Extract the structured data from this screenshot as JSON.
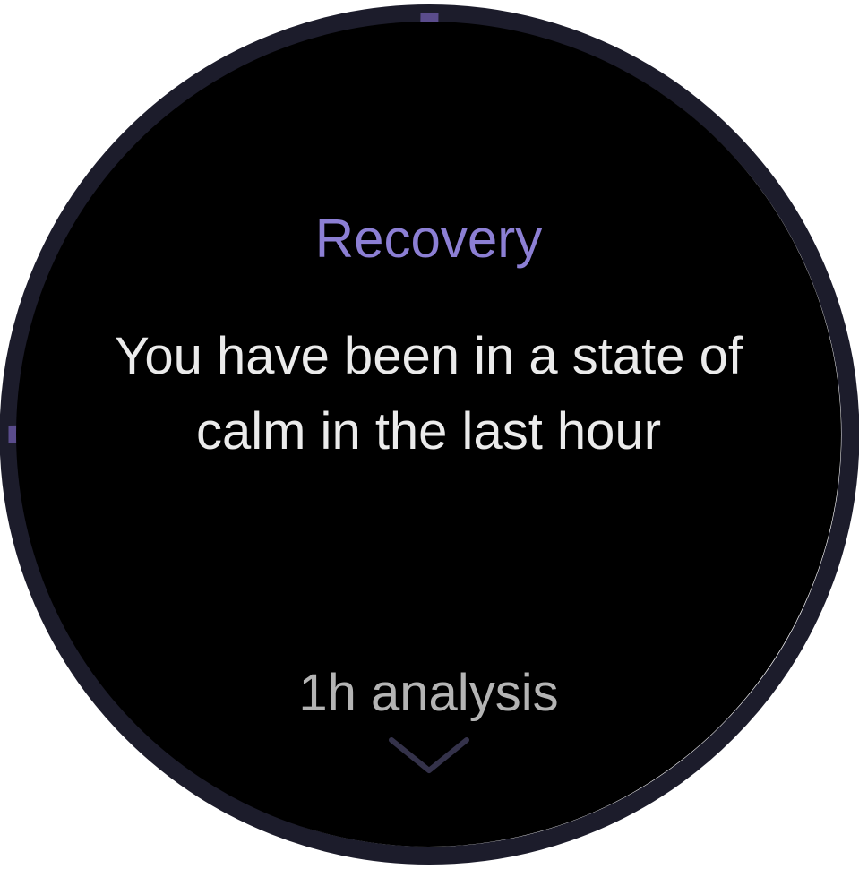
{
  "app": {
    "title": "Recovery"
  },
  "content": {
    "message": "You have been in a state of calm in the last hour"
  },
  "analysis": {
    "label": "1h analysis",
    "icon": "chevron-down-icon"
  },
  "progress": {
    "fraction": 0.25
  },
  "colors": {
    "accent": "#8c7fd4",
    "progress": "#5a4c8c",
    "track": "#1c1c2b",
    "background": "#000000",
    "text": "#ebebeb",
    "muted": "#b4b4b4"
  }
}
